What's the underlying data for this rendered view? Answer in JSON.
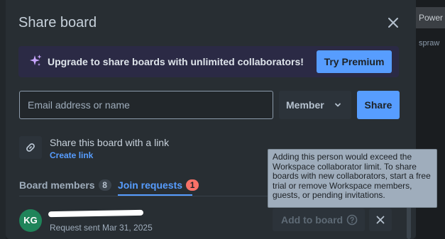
{
  "background": {
    "chip_label": "Power",
    "peek_label": "spraw"
  },
  "dialog": {
    "title": "Share board",
    "close_icon": "close-icon",
    "upsell": {
      "icon": "sparkle-icon",
      "text": "Upgrade to share boards with unlimited collaborators!",
      "button_label": "Try Premium"
    },
    "invite": {
      "placeholder": "Email address or name",
      "role_value": "Member",
      "share_label": "Share"
    },
    "link": {
      "icon": "link-icon",
      "title": "Share this board with a link",
      "action_label": "Create link"
    },
    "tabs": [
      {
        "label": "Board members",
        "count": "8",
        "active": false
      },
      {
        "label": "Join requests",
        "count": "1",
        "active": true
      }
    ],
    "request": {
      "initials": "KG",
      "meta": "Request sent Mar 31, 2025",
      "add_label": "Add to board",
      "help_icon": "help-circle-icon",
      "remove_icon": "close-icon"
    },
    "tooltip": "Adding this person would exceed the Workspace collaborator limit. To share boards with new collaborators, start a free trial or remove Workspace members, guests, or pending invitations."
  },
  "colors": {
    "accent": "#579dff",
    "dialog_bg": "#282e33",
    "upsell_bg": "#2b2a45",
    "badge_red": "#f87168",
    "avatar_green": "#1f845a",
    "tooltip_bg": "#9fadbc"
  }
}
